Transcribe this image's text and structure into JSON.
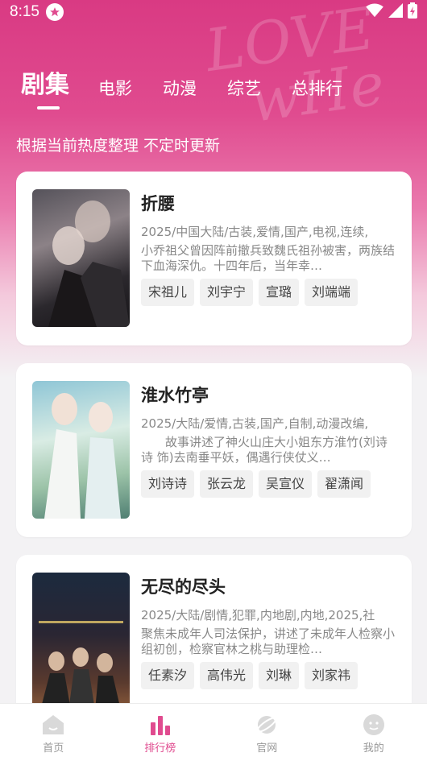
{
  "status_bar": {
    "time": "8:15",
    "icons": [
      "star-badge-icon",
      "wifi-icon",
      "signal-icon",
      "battery-charging-icon"
    ]
  },
  "tabs": [
    {
      "label": "剧集",
      "active": true
    },
    {
      "label": "电影",
      "active": false
    },
    {
      "label": "动漫",
      "active": false
    },
    {
      "label": "综艺",
      "active": false
    },
    {
      "label": "总排行",
      "active": false
    }
  ],
  "subtitle": "根据当前热度整理 不定时更新",
  "shows": [
    {
      "title": "折腰",
      "meta": "2025/中国大陆/古装,爱情,国产,电视,连续,",
      "desc": "小乔祖父曾因阵前撤兵致魏氏祖孙被害，两族结下血海深仇。十四年后，当年幸…",
      "actors": [
        "宋祖儿",
        "刘宇宁",
        "宣璐",
        "刘端端"
      ],
      "poster_colors": [
        "#3b3a3f",
        "#7b6f73",
        "#1f1d22"
      ]
    },
    {
      "title": "淮水竹亭",
      "meta": "2025/大陆/爱情,古装,国产,自制,动漫改编,",
      "desc": "　　故事讲述了神火山庄大小姐东方淮竹(刘诗诗 饰)去南垂平妖，偶遇行侠仗义…",
      "actors": [
        "刘诗诗",
        "张云龙",
        "吴宣仪",
        "翟潇闻"
      ],
      "poster_colors": [
        "#6fb3c4",
        "#cfe5dc",
        "#4f7f72"
      ]
    },
    {
      "title": "无尽的尽头",
      "meta": "2025/大陆/剧情,犯罪,内地剧,内地,2025,社",
      "desc": "聚焦未成年人司法保护，讲述了未成年人检察小组初创，检察官林之桃与助理检…",
      "actors": [
        "任素汐",
        "高伟光",
        "刘琳",
        "刘家祎"
      ],
      "poster_colors": [
        "#1d2a3d",
        "#3a2a2a",
        "#8a5a3a"
      ]
    }
  ],
  "bottom_nav": [
    {
      "label": "首页",
      "icon": "home-icon",
      "active": false
    },
    {
      "label": "排行榜",
      "icon": "ranking-icon",
      "active": true
    },
    {
      "label": "官网",
      "icon": "planet-icon",
      "active": false
    },
    {
      "label": "我的",
      "icon": "profile-face-icon",
      "active": false
    }
  ],
  "colors": {
    "accent": "#e04b8f",
    "hero_top": "#d93a83"
  }
}
